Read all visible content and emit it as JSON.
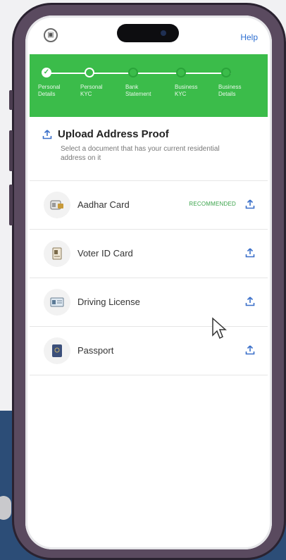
{
  "header": {
    "help_label": "Help",
    "logo": "app-logo-icon"
  },
  "stepper": {
    "color": "#3bbc4a",
    "steps": [
      {
        "label_line1": "Personal",
        "label_line2": "Details",
        "state": "done"
      },
      {
        "label_line1": "Personal",
        "label_line2": "KYC",
        "state": "current"
      },
      {
        "label_line1": "Bank",
        "label_line2": "Statement",
        "state": "pending"
      },
      {
        "label_line1": "Business",
        "label_line2": "KYC",
        "state": "pending"
      },
      {
        "label_line1": "Business",
        "label_line2": "Details",
        "state": "pending"
      }
    ]
  },
  "upload_section": {
    "title": "Upload Address Proof",
    "description": "Select a document that has your current residential address on it"
  },
  "documents": [
    {
      "name": "Aadhar Card",
      "badge": "RECOMMENDED",
      "icon": "aadhar-card-icon"
    },
    {
      "name": "Voter ID Card",
      "badge": "",
      "icon": "voter-id-icon"
    },
    {
      "name": "Driving License",
      "badge": "",
      "icon": "driving-license-icon"
    },
    {
      "name": "Passport",
      "badge": "",
      "icon": "passport-icon"
    }
  ],
  "colors": {
    "accent": "#3bbc4a",
    "link": "#2e6fd1",
    "background_band": "#2c4d77"
  }
}
